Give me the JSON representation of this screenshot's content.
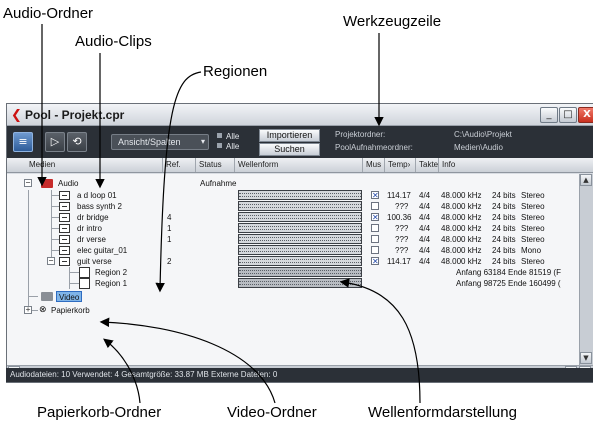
{
  "callouts": {
    "audio_ordner": "Audio-Ordner",
    "audio_clips": "Audio-Clips",
    "werkzeugzeile": "Werkzeugzeile",
    "regionen": "Regionen",
    "papierkorb_ordner": "Papierkorb-Ordner",
    "video_ordner": "Video-Ordner",
    "wellenformdarstellung": "Wellenformdarstellung"
  },
  "window": {
    "title": "Pool - Projekt.cpr",
    "minimize": "_",
    "maximize": "□",
    "close": "X"
  },
  "toolbar": {
    "view_select": "Ansicht/Spalten",
    "alle_1": "Alle",
    "alle_2": "Alle",
    "import_button": "Importieren",
    "search_button": "Suchen",
    "project_folder_label": "Projektordner:",
    "project_folder_value": "C:\\Audio\\Projekt",
    "record_folder_label": "PoolAufnahmeordner:",
    "record_folder_value": "Medien\\Audio"
  },
  "columns": {
    "medien": "Medien",
    "ref": "Ref.",
    "status": "Status",
    "wellenform": "Wellenform",
    "mus": "Mus",
    "tempo": "Temp›",
    "takte": "Takte",
    "info": "Info"
  },
  "tree": {
    "audio_folder": "Audio",
    "audio_status": "Aufnahme",
    "clips": [
      {
        "name": "a d loop 01",
        "ref": "",
        "mus": true,
        "tempo": "114.17",
        "sig": "4/4",
        "rate": "48.000 kHz",
        "bits": "24 bits",
        "ch": "Stereo"
      },
      {
        "name": "bass synth 2",
        "ref": "",
        "mus": false,
        "tempo": "???",
        "sig": "4/4",
        "rate": "48.000 kHz",
        "bits": "24 bits",
        "ch": "Stereo"
      },
      {
        "name": "dr bridge",
        "ref": "4",
        "mus": true,
        "tempo": "100.36",
        "sig": "4/4",
        "rate": "48.000 kHz",
        "bits": "24 bits",
        "ch": "Stereo"
      },
      {
        "name": "dr intro",
        "ref": "1",
        "mus": false,
        "tempo": "???",
        "sig": "4/4",
        "rate": "48.000 kHz",
        "bits": "24 bits",
        "ch": "Stereo"
      },
      {
        "name": "dr verse",
        "ref": "1",
        "mus": false,
        "tempo": "???",
        "sig": "4/4",
        "rate": "48.000 kHz",
        "bits": "24 bits",
        "ch": "Stereo"
      },
      {
        "name": "elec guitar_01",
        "ref": "",
        "mus": false,
        "tempo": "???",
        "sig": "4/4",
        "rate": "48.000 kHz",
        "bits": "24 bits",
        "ch": "Mono"
      },
      {
        "name": "guit verse",
        "ref": "2",
        "mus": true,
        "tempo": "114.17",
        "sig": "4/4",
        "rate": "48.000 kHz",
        "bits": "24 bits",
        "ch": "Stereo"
      }
    ],
    "regions": [
      {
        "name": "Region 2",
        "info": "Anfang 63184  Ende 81519 (F"
      },
      {
        "name": "Region 1",
        "info": "Anfang 98725  Ende 160499 ("
      }
    ],
    "video_folder": "Video",
    "trash_folder": "Papierkorb"
  },
  "statusbar": {
    "text": "Audiodateien: 10   Verwendet: 4   Gesamtgröße: 33.87 MB   Externe Dateien: 0"
  }
}
